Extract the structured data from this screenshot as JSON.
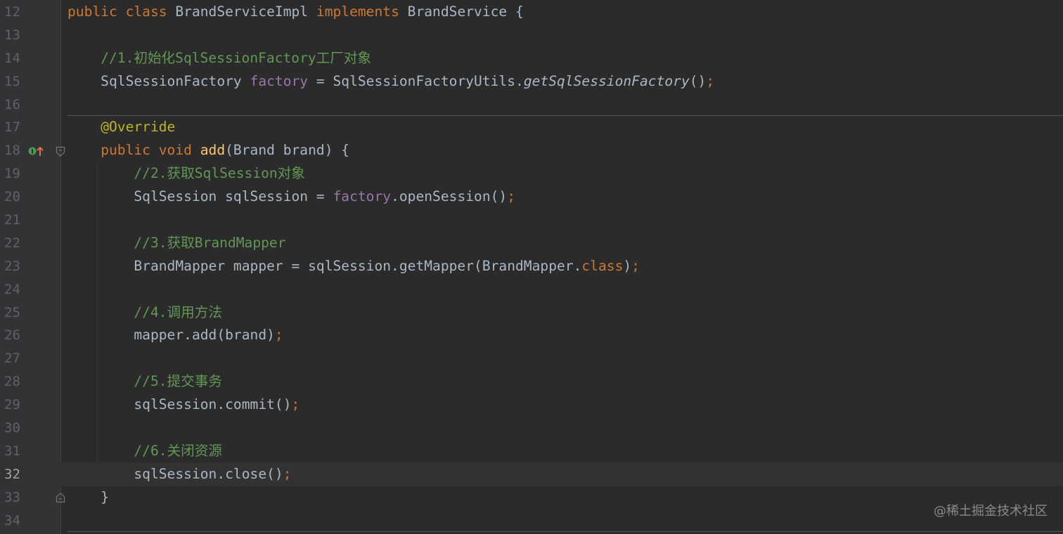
{
  "editor": {
    "current_line": 32,
    "lines": [
      {
        "no": "12",
        "tokens": [
          [
            "kw",
            "public "
          ],
          [
            "kw",
            "class "
          ],
          [
            "plain",
            "BrandServiceImpl "
          ],
          [
            "kw",
            "implements "
          ],
          [
            "plain",
            "BrandService {"
          ]
        ]
      },
      {
        "no": "13",
        "tokens": []
      },
      {
        "no": "14",
        "tokens": [
          [
            "plain",
            "    "
          ],
          [
            "cm",
            "//1.初始化SqlSessionFactory工厂对象"
          ]
        ]
      },
      {
        "no": "15",
        "tokens": [
          [
            "plain",
            "    SqlSessionFactory "
          ],
          [
            "fld",
            "factory"
          ],
          [
            "plain",
            " = SqlSessionFactoryUtils."
          ],
          [
            "it",
            "getSqlSessionFactory"
          ],
          [
            "plain",
            "()"
          ],
          [
            "kw",
            ";"
          ]
        ]
      },
      {
        "no": "16",
        "tokens": []
      },
      {
        "no": "17",
        "tokens": [
          [
            "plain",
            "    "
          ],
          [
            "ann",
            "@Override"
          ]
        ]
      },
      {
        "no": "18",
        "tokens": [
          [
            "plain",
            "    "
          ],
          [
            "kw",
            "public "
          ],
          [
            "kw",
            "void "
          ],
          [
            "mth",
            "add"
          ],
          [
            "plain",
            "(Brand brand) {"
          ]
        ]
      },
      {
        "no": "19",
        "tokens": [
          [
            "plain",
            "        "
          ],
          [
            "cm",
            "//2.获取SqlSession对象"
          ]
        ]
      },
      {
        "no": "20",
        "tokens": [
          [
            "plain",
            "        SqlSession sqlSession = "
          ],
          [
            "fld",
            "factory"
          ],
          [
            "plain",
            ".openSession()"
          ],
          [
            "kw",
            ";"
          ]
        ]
      },
      {
        "no": "21",
        "tokens": []
      },
      {
        "no": "22",
        "tokens": [
          [
            "plain",
            "        "
          ],
          [
            "cm",
            "//3.获取BrandMapper"
          ]
        ]
      },
      {
        "no": "23",
        "tokens": [
          [
            "plain",
            "        BrandMapper mapper = sqlSession.getMapper(BrandMapper."
          ],
          [
            "kw",
            "class"
          ],
          [
            "plain",
            ")"
          ],
          [
            "kw",
            ";"
          ]
        ]
      },
      {
        "no": "24",
        "tokens": []
      },
      {
        "no": "25",
        "tokens": [
          [
            "plain",
            "        "
          ],
          [
            "cm",
            "//4.调用方法"
          ]
        ]
      },
      {
        "no": "26",
        "tokens": [
          [
            "plain",
            "        mapper.add(brand)"
          ],
          [
            "kw",
            ";"
          ]
        ]
      },
      {
        "no": "27",
        "tokens": []
      },
      {
        "no": "28",
        "tokens": [
          [
            "plain",
            "        "
          ],
          [
            "cm",
            "//5.提交事务"
          ]
        ]
      },
      {
        "no": "29",
        "tokens": [
          [
            "plain",
            "        sqlSession.commit()"
          ],
          [
            "kw",
            ";"
          ]
        ]
      },
      {
        "no": "30",
        "tokens": []
      },
      {
        "no": "31",
        "tokens": [
          [
            "plain",
            "        "
          ],
          [
            "cm",
            "//6.关闭资源"
          ]
        ]
      },
      {
        "no": "32",
        "tokens": [
          [
            "plain",
            "        sqlSession.close()"
          ],
          [
            "kw",
            ";"
          ]
        ]
      },
      {
        "no": "33",
        "tokens": [
          [
            "plain",
            "    }"
          ]
        ]
      },
      {
        "no": "34",
        "tokens": []
      }
    ]
  },
  "icons": {
    "implements_marker": "implements-method-icon",
    "fold_marker": "fold-icon"
  },
  "watermark": "@稀土掘金技术社区",
  "colors": {
    "background": "#2b2b2b",
    "gutter": "#313335",
    "keyword": "#cc7832",
    "comment": "#629755",
    "field": "#9876aa",
    "annotation": "#bbb529",
    "method_decl": "#ffc66d",
    "plain": "#a9b7c6",
    "line_number": "#606366"
  }
}
